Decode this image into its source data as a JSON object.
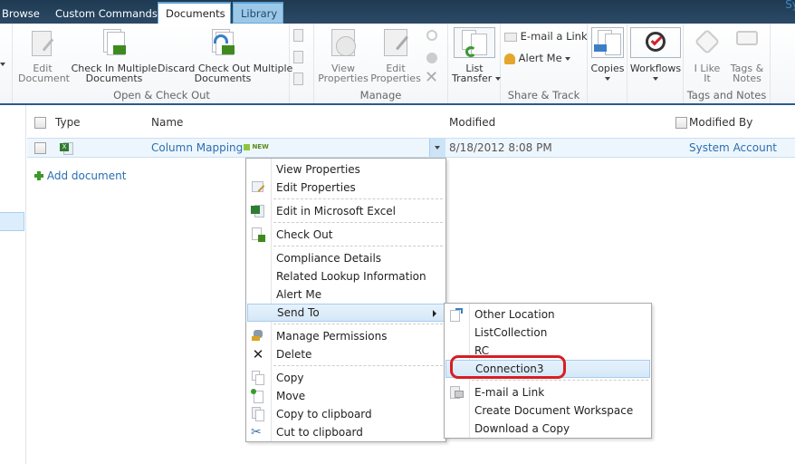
{
  "tabs": [
    {
      "label": "Browse",
      "state": "normal"
    },
    {
      "label": "Custom Commands",
      "state": "normal"
    },
    {
      "label": "Documents",
      "state": "active"
    },
    {
      "label": "Library",
      "state": "contextual"
    }
  ],
  "topbar_user_partial": "Sy",
  "ribbon": {
    "groups": {
      "open_checkout": {
        "label": "Open & Check Out",
        "buttons": [
          {
            "label_line1": "Edit",
            "label_line2": "Document",
            "icon": "edit-document-icon"
          },
          {
            "label_line1": "Check In Multiple",
            "label_line2": "Documents",
            "icon": "check-in-multiple-icon"
          },
          {
            "label_line1": "Discard Check Out Multiple",
            "label_line2": "Documents",
            "icon": "discard-checkout-icon"
          }
        ]
      },
      "manage": {
        "label": "Manage",
        "buttons": [
          {
            "label_line1": "View",
            "label_line2": "Properties",
            "icon": "view-properties-icon"
          },
          {
            "label_line1": "Edit",
            "label_line2": "Properties",
            "icon": "edit-properties-icon"
          }
        ]
      },
      "list_transfer": {
        "label_line1": "List",
        "label_line2": "Transfer",
        "icon": "list-transfer-icon"
      },
      "share_track": {
        "label": "Share & Track",
        "email_link": "E-mail a Link",
        "alert_me": "Alert Me"
      },
      "copies": {
        "label": "Copies"
      },
      "workflows": {
        "label": "Workflows"
      },
      "tags_notes": {
        "label": "Tags and Notes",
        "i_like_it_line1": "I Like",
        "i_like_it_line2": "It",
        "tags_line1": "Tags &",
        "tags_line2": "Notes"
      }
    }
  },
  "list": {
    "columns": {
      "type": "Type",
      "name": "Name",
      "modified": "Modified",
      "modified_by": "Modified By"
    },
    "rows": [
      {
        "name": "Column Mapping",
        "badge": "NEW",
        "modified": "8/18/2012 8:08 PM",
        "modified_by": "System Account",
        "type_icon": "excel-file-icon"
      }
    ],
    "add_document": "Add document"
  },
  "context_menu": {
    "items": [
      {
        "label": "View Properties",
        "icon": ""
      },
      {
        "label": "Edit Properties",
        "icon": "edit-properties-icon"
      },
      {
        "label": "Edit in Microsoft Excel",
        "icon": "excel-icon"
      },
      {
        "label": "Check Out",
        "icon": "check-out-icon"
      },
      {
        "label": "Compliance Details",
        "icon": ""
      },
      {
        "label": "Related Lookup Information",
        "icon": ""
      },
      {
        "label": "Alert Me",
        "icon": ""
      },
      {
        "label": "Send To",
        "icon": "",
        "has_submenu": true,
        "highlighted": true
      },
      {
        "label": "Manage Permissions",
        "icon": "permissions-icon"
      },
      {
        "label": "Delete",
        "icon": "delete-icon"
      },
      {
        "label": "Copy",
        "icon": "copy-icon"
      },
      {
        "label": "Move",
        "icon": "move-icon"
      },
      {
        "label": "Copy to clipboard",
        "icon": "clipboard-icon"
      },
      {
        "label": "Cut to clipboard",
        "icon": "scissors-icon"
      }
    ]
  },
  "send_to_menu": {
    "items": [
      {
        "label": "Other Location",
        "icon": "other-location-icon"
      },
      {
        "label": "ListCollection",
        "icon": ""
      },
      {
        "label": "RC",
        "icon": ""
      },
      {
        "label": "Connection3",
        "icon": "",
        "highlighted": true,
        "annotated": true
      },
      {
        "label": "E-mail a Link",
        "icon": "email-link-icon"
      },
      {
        "label": "Create Document Workspace",
        "icon": ""
      },
      {
        "label": "Download a Copy",
        "icon": ""
      }
    ]
  },
  "colors": {
    "topbar": "#1f3a52",
    "link": "#2a6fb0",
    "highlight": "#d5e8f8",
    "annotation_red": "#d81e24"
  }
}
